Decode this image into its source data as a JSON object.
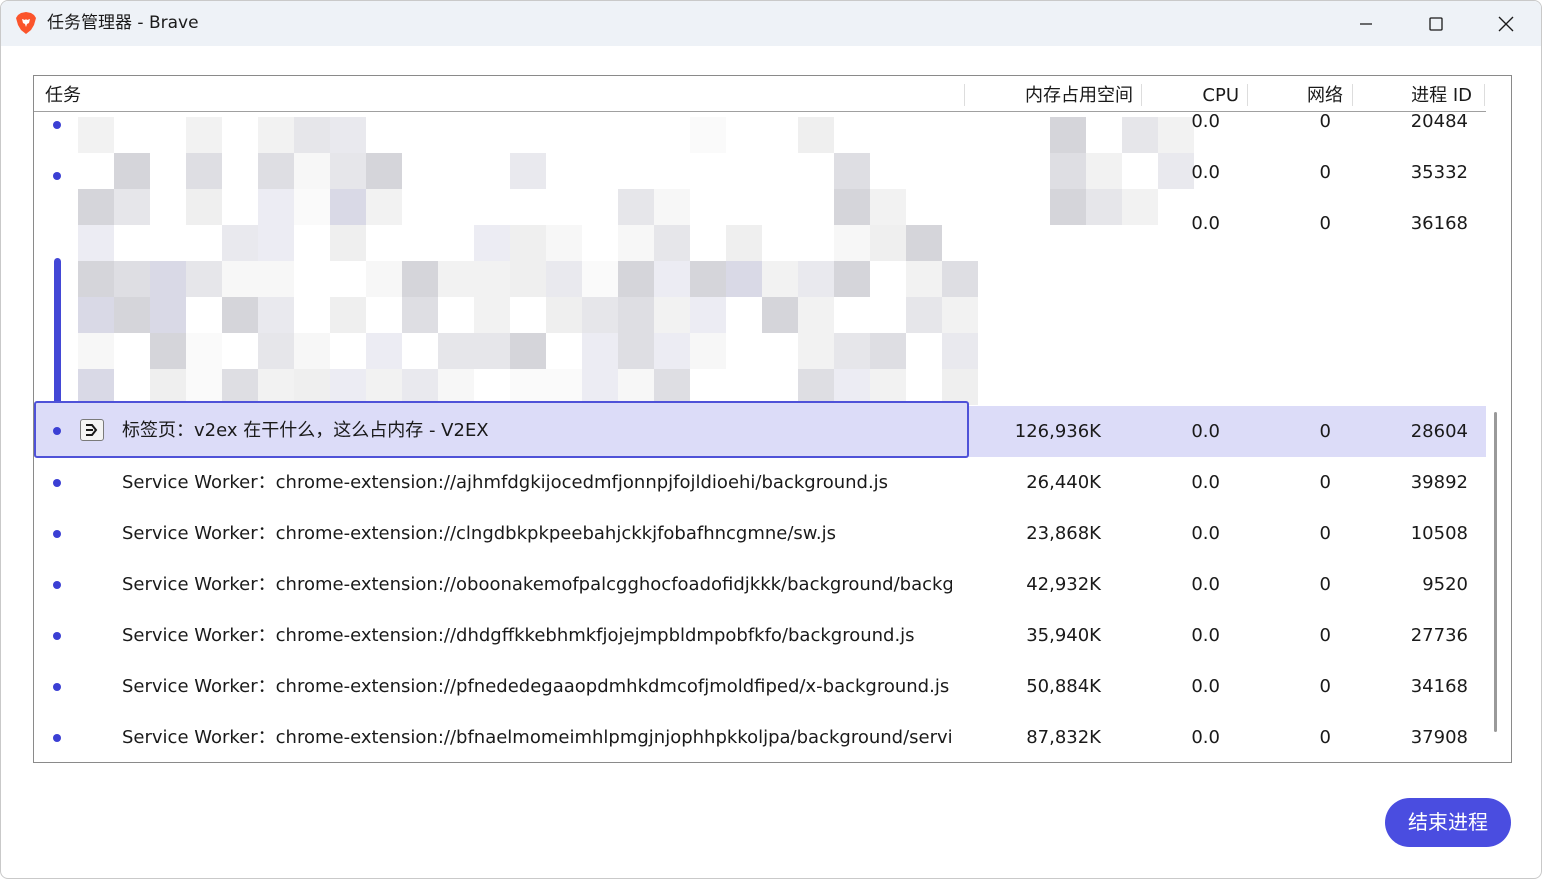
{
  "window": {
    "title": "任务管理器 - Brave"
  },
  "columns": {
    "task": "任务",
    "memory": "内存占用空间",
    "cpu": "CPU",
    "network": "网络",
    "pid": "进程 ID"
  },
  "rows": [
    {
      "task": "",
      "memory": "",
      "cpu": "0.0",
      "network": "0",
      "pid": "20484"
    },
    {
      "task": "",
      "memory": "",
      "cpu": "0.0",
      "network": "0",
      "pid": "35332"
    },
    {
      "task": "",
      "memory": "",
      "cpu": "0.0",
      "network": "0",
      "pid": "36168"
    },
    {
      "task": "标签页：v2ex 在干什么，这么占内存 - V2EX",
      "memory": "126,936K",
      "cpu": "0.0",
      "network": "0",
      "pid": "28604",
      "selected": true
    },
    {
      "task": "Service Worker：chrome-extension://ajhmfdgkijocedmfjonnpjfojldioehi/background.js",
      "memory": "26,440K",
      "cpu": "0.0",
      "network": "0",
      "pid": "39892"
    },
    {
      "task": "Service Worker：chrome-extension://clngdbkpkpeebahjckkjfobafhncgmne/sw.js",
      "memory": "23,868K",
      "cpu": "0.0",
      "network": "0",
      "pid": "10508"
    },
    {
      "task": "Service Worker：chrome-extension://oboonakemofpalcgghocfoadofidjkkk/background/backgro",
      "memory": "42,932K",
      "cpu": "0.0",
      "network": "0",
      "pid": "9520"
    },
    {
      "task": "Service Worker：chrome-extension://dhdgffkkebhmkfjojejmpbldmpobfkfo/background.js",
      "memory": "35,940K",
      "cpu": "0.0",
      "network": "0",
      "pid": "27736"
    },
    {
      "task": "Service Worker：chrome-extension://pfnededegaaopdmhkdmcofjmoldfiped/x-background.js",
      "memory": "50,884K",
      "cpu": "0.0",
      "network": "0",
      "pid": "34168"
    },
    {
      "task": "Service Worker：chrome-extension://bfnaelmomeimhlpmgjnjophhpkkoljpa/background/service",
      "memory": "87,832K",
      "cpu": "0.0",
      "network": "0",
      "pid": "37908"
    }
  ],
  "footer": {
    "end_process_label": "结束进程"
  },
  "colors": {
    "accent": "#4a4de0",
    "selection": "#dcdcf8",
    "brave_orange": "#fb542b"
  },
  "icons": {
    "app": "brave-lion-icon",
    "tab": "tab-page-icon"
  }
}
